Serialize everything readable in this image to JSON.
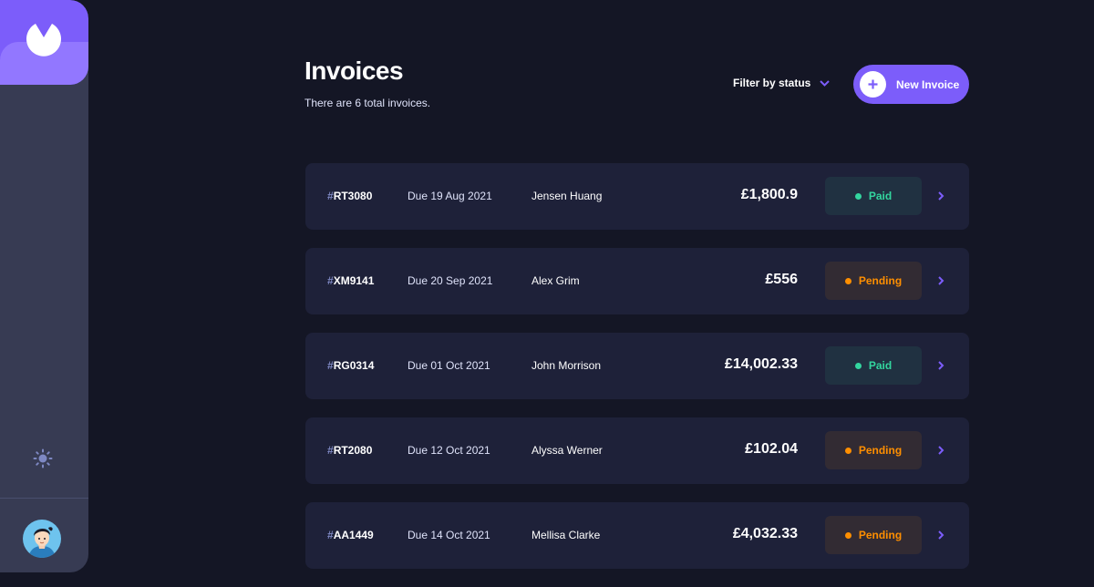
{
  "header": {
    "title": "Invoices",
    "subtitle": "There are 6 total invoices.",
    "filter_label": "Filter by status",
    "new_invoice_label": "New Invoice"
  },
  "colors": {
    "accent": "#7c5dfa",
    "paid": "#33d69f",
    "pending": "#ff8f00",
    "background": "#141625",
    "card": "#1e2139",
    "sidebar": "#373b53"
  },
  "icons": {
    "logo": "logo-icon",
    "theme": "sun-icon",
    "filter": "chevron-down-icon",
    "new": "plus-icon",
    "row": "chevron-right-icon"
  },
  "invoices": [
    {
      "hash": "#",
      "id": "RT3080",
      "due": "Due 19 Aug 2021",
      "client": "Jensen Huang",
      "amount": "£1,800.9",
      "status": "Paid",
      "status_key": "paid"
    },
    {
      "hash": "#",
      "id": "XM9141",
      "due": "Due 20 Sep 2021",
      "client": "Alex Grim",
      "amount": "£556",
      "status": "Pending",
      "status_key": "pending"
    },
    {
      "hash": "#",
      "id": "RG0314",
      "due": "Due 01 Oct 2021",
      "client": "John Morrison",
      "amount": "£14,002.33",
      "status": "Paid",
      "status_key": "paid"
    },
    {
      "hash": "#",
      "id": "RT2080",
      "due": "Due 12 Oct 2021",
      "client": "Alyssa Werner",
      "amount": "£102.04",
      "status": "Pending",
      "status_key": "pending"
    },
    {
      "hash": "#",
      "id": "AA1449",
      "due": "Due 14 Oct 2021",
      "client": "Mellisa Clarke",
      "amount": "£4,032.33",
      "status": "Pending",
      "status_key": "pending"
    }
  ]
}
